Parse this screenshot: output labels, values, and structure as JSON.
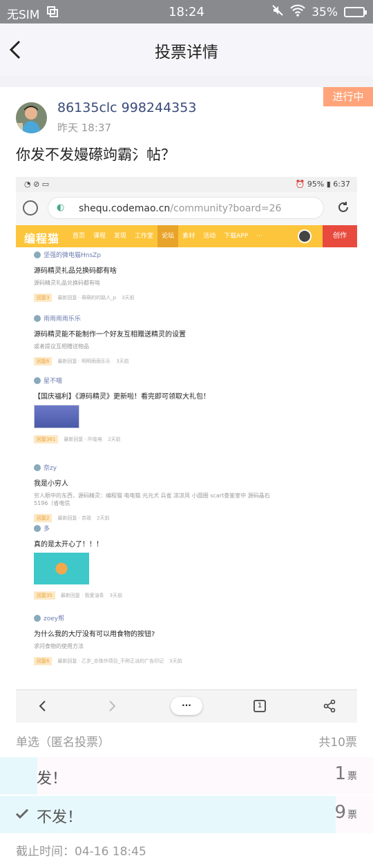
{
  "status": {
    "carrier": "无SIM",
    "time": "18:24",
    "battery": "35%"
  },
  "nav": {
    "title": "投票详情"
  },
  "post": {
    "badge": "进行中",
    "author": "86135clc 998244353",
    "time": "昨天 18:37",
    "title": "你发不发嫚礤竘霸氵帖？"
  },
  "screenshot": {
    "phone_battery": "95%",
    "phone_time": "6:37",
    "url_host": "shequ.codemao.cn",
    "url_path": "/community?board=26",
    "site_logo": "编程猫",
    "site_tabs": [
      "首页",
      "课程",
      "发现",
      "工作室",
      "论坛",
      "素材",
      "活动",
      "下载APP",
      "···"
    ],
    "active_tab": "论坛",
    "create_label": "创作",
    "feed": [
      {
        "user": "坚强的微电猫HnsZp",
        "title": "源码精灵礼品兑换码都有啥",
        "summary": "源码精灵礼品兑换码都有啥",
        "tag": "回复3",
        "meta": "最新回复 · 萌萌的的路人_p",
        "ago": "3天前"
      },
      {
        "user": "雨雨雨雨乐乐",
        "title": "源码精灵能不能制作一个好友互相赠送精灵的设置",
        "summary": "或者提议互相赠送物品",
        "tag": "回复6",
        "meta": "最新回复 · 明明雨雨乐乐",
        "ago": "3天前"
      },
      {
        "user": "星不喵",
        "title": "【国庆福利】《源码精灵》更新啦！看完即可领取大礼包！",
        "summary": "",
        "tag": "回复361",
        "meta": "最新回复 · 阡临电",
        "ago": "2天前"
      },
      {
        "user": "奈zy",
        "title": "我是小穷人",
        "summary": "穷人眼中的东西，源码精灵：编程猫 电电猫 元元犬 兵雀 凉凉凤 小圆圈 scart查鉴室中 源码晶石5196（省电信",
        "tag": "回复2",
        "meta": "最新回复 · 奈政",
        "ago": "2天前"
      },
      {
        "user": "多",
        "title": "真的是太开心了！！！",
        "summary": "",
        "tag": "回复35",
        "meta": "最新回复 · 我爱油条",
        "ago": "3天前"
      },
      {
        "user": "zoey帮",
        "title": "为什么我的大厅没有可以用食物的按钮?",
        "summary": "求问食物的使用方法",
        "tag": "回复6",
        "meta": "最新回复 · 乙岁_亦珠作项目_不称正派的广告印记",
        "ago": "3天前"
      }
    ]
  },
  "vote": {
    "type": "单选（匿名投票）",
    "total": "共10票",
    "unit": "票",
    "options": [
      {
        "label": "发！",
        "count": "1",
        "fraction": 0.1,
        "selected": false
      },
      {
        "label": "不发！",
        "count": "9",
        "fraction": 0.9,
        "selected": true
      }
    ],
    "deadline": "截止时间：04-16 18:45"
  },
  "colors": {
    "badge": "#ffa47a",
    "vote_bar": "#e7f8fc",
    "site_nav": "#fcc53b"
  }
}
